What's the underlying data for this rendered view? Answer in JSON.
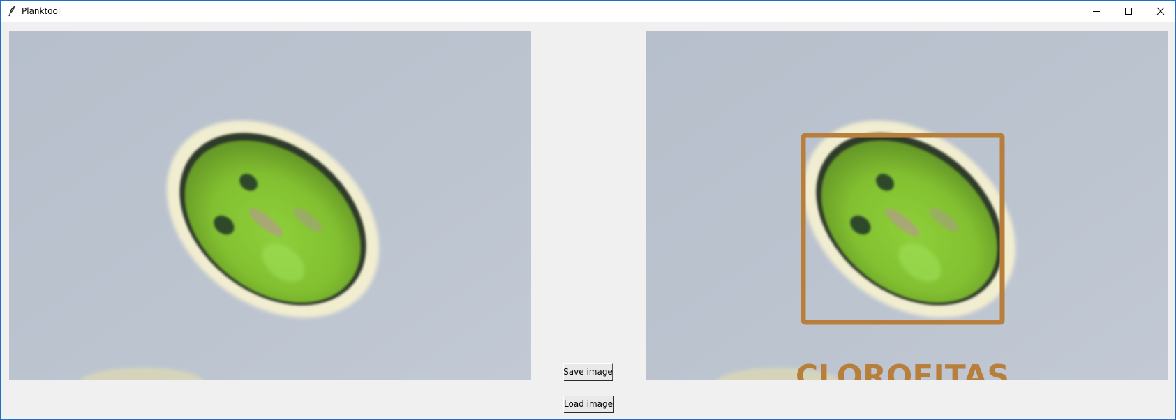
{
  "window": {
    "title": "Planktool",
    "icon": "feather-icon",
    "controls": [
      "minimize-icon",
      "maximize-icon",
      "close-icon"
    ]
  },
  "left_panel": {
    "content": "plankton-microscope-image"
  },
  "right_panel": {
    "content": "plankton-microscope-image-annotated",
    "detection": {
      "label": "CLOROFITAS",
      "box_color": "#b87f3c"
    }
  },
  "buttons": {
    "save_label": "Save image",
    "load_label": "Load image"
  },
  "colors": {
    "background": "#f0f0f0",
    "title_bar": "#ffffff",
    "window_border": "#1e6fc8",
    "annotation": "#b87f3c"
  }
}
